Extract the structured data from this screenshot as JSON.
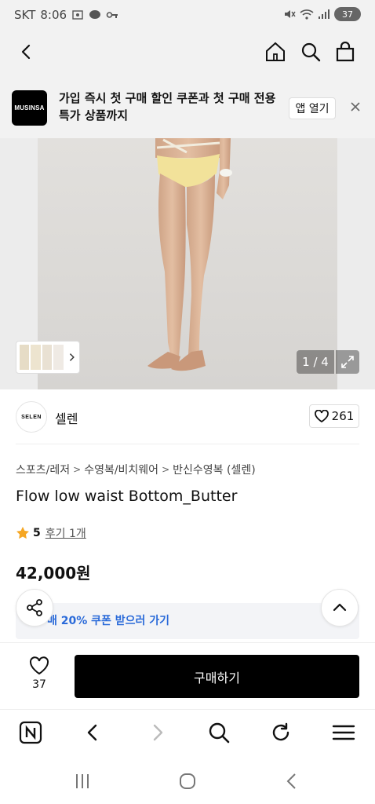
{
  "status_bar": {
    "carrier": "SKT",
    "time": "8:06",
    "battery": "37"
  },
  "top_nav": {
    "back_icon": "chevron-left-icon",
    "home_icon": "home-icon",
    "search_icon": "search-icon",
    "cart_icon": "shopping-bag-icon"
  },
  "app_banner": {
    "logo_text": "MUSINSA",
    "message_line1": "가입 즉시 첫 구매 할인 쿠폰과 첫 구매 전용",
    "message_line2": "특가 상품까지",
    "open_app_label": "앱 열기"
  },
  "gallery": {
    "page_indicator": "1 / 4"
  },
  "brand": {
    "logo_text": "SELEN",
    "name": "셀렌",
    "like_count": "261"
  },
  "breadcrumb": [
    "스포츠/레저",
    "수영복/비치웨어",
    "반신수영복 (셀렌)"
  ],
  "product": {
    "title": "Flow low waist Bottom_Butter",
    "rating_score": "5",
    "review_text": "후기 1개",
    "price": "42,000원"
  },
  "coupon": {
    "text": "구매 20% 쿠폰 받으러 가기",
    "visible_text": "매 20% 쿠폰 받으러 가기"
  },
  "purchase_bar": {
    "wish_count": "37",
    "buy_label": "구매하기"
  },
  "colors": {
    "accent_blue": "#2a6ad9",
    "star": "#f5a623",
    "buy_button": "#000000"
  }
}
